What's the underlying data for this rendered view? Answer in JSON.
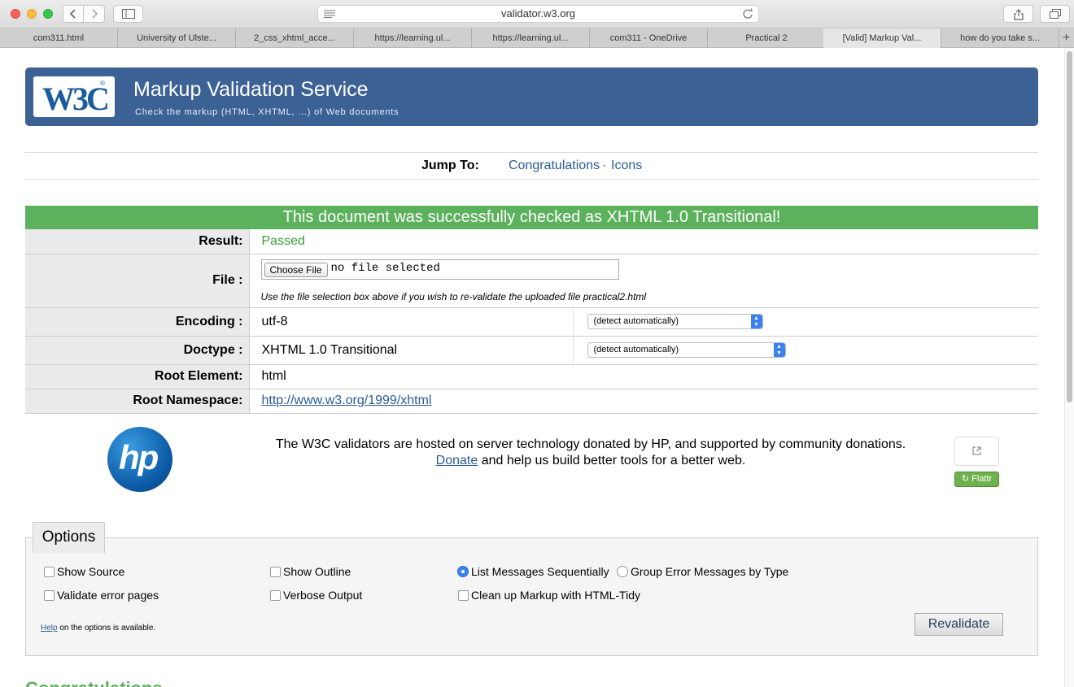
{
  "browser": {
    "url": "validator.w3.org",
    "tabs": [
      {
        "label": "com311.html"
      },
      {
        "label": "University of Ulste..."
      },
      {
        "label": "2_css_xhtml_acce..."
      },
      {
        "label": "https://learning.ul..."
      },
      {
        "label": "https://learning.ul..."
      },
      {
        "label": "com311 - OneDrive"
      },
      {
        "label": "Practical 2"
      },
      {
        "label": "[Valid] Markup Val..."
      },
      {
        "label": "how do you take s..."
      }
    ],
    "new_tab_label": "+"
  },
  "header": {
    "logo_text": "W3C",
    "logo_reg": "®",
    "title": "Markup Validation Service",
    "subtitle": "Check the markup (HTML, XHTML, ...) of Web documents"
  },
  "jump": {
    "label": "Jump To:",
    "links": [
      "Congratulations",
      "Icons"
    ],
    "separator": "·"
  },
  "result_banner": "This document was successfully checked as XHTML 1.0 Transitional!",
  "results": {
    "result_label": "Result:",
    "result_value": "Passed",
    "file_label": "File :",
    "choose_file": "Choose File",
    "no_file": "no file selected",
    "file_hint": "Use the file selection box above if you wish to re-validate the uploaded file practical2.html",
    "encoding_label": "Encoding :",
    "encoding_value": "utf-8",
    "encoding_select": "(detect automatically)",
    "doctype_label": "Doctype :",
    "doctype_value": "XHTML 1.0 Transitional",
    "doctype_select": "(detect automatically)",
    "root_label": "Root Element:",
    "root_value": "html",
    "ns_label": "Root Namespace:",
    "ns_value": "http://www.w3.org/1999/xhtml"
  },
  "sponsor": {
    "logo_text": "hp",
    "line1": "The W3C validators are hosted on server technology donated by HP, and supported by community donations.",
    "donate_link": "Donate",
    "line2": " and help us build better tools for a better web.",
    "flattr": "Flattr"
  },
  "options": {
    "title": "Options",
    "show_source": "Show Source",
    "show_outline": "Show Outline",
    "list_sequential": "List Messages Sequentially",
    "group_by_type": "Group Error Messages by Type",
    "validate_error_pages": "Validate error pages",
    "verbose_output": "Verbose Output",
    "cleanup_tidy": "Clean up Markup with HTML-Tidy",
    "help_link": "Help",
    "help_text": " on the options is available.",
    "revalidate": "Revalidate"
  },
  "next_section": "Congratulations"
}
